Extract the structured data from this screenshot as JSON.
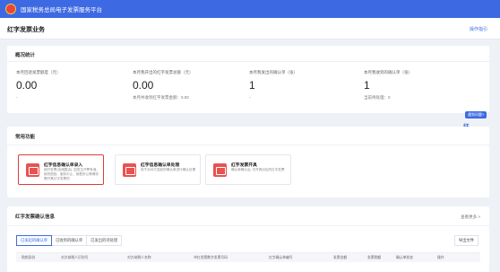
{
  "topbar": {
    "title": "国家税务总局电子发票服务平台"
  },
  "page": {
    "title": "红字发票业务",
    "guide": "操作指引"
  },
  "overview": {
    "title": "概况统计",
    "stats": [
      {
        "label": "本月回退发票额度（元）",
        "value": "0.00",
        "sub": "-"
      },
      {
        "label": "本月我开出的红字发票总额（元）",
        "value": "0.00",
        "sub": "本月共收到红字发票金额：0.00"
      },
      {
        "label": "本月我发出的确认单（张）",
        "value": "1",
        "sub": "-"
      },
      {
        "label": "本月我收到的确认单（张）",
        "value": "1",
        "sub": "当前待处理：0"
      }
    ]
  },
  "functions": {
    "title": "常用功能",
    "items": [
      {
        "name": "红字信息确认单录入",
        "desc": "填开发票(含调整)后, 如发生开票有误、销货退回、服务中止、销售折让等情形需开具红字发票的"
      },
      {
        "name": "红字信息确认单处理",
        "desc": "用于对对方发起的确认单进行确认处理"
      },
      {
        "name": "红字发票开具",
        "desc": "确认单确认后, 可开具对应的红字发票"
      }
    ]
  },
  "helper": {
    "tag": "遇到问题?",
    "chars": [
      "征",
      "纳",
      "互",
      "动"
    ]
  },
  "confirm": {
    "title": "红字发票确认信息",
    "more": "查看更多 >",
    "tabs": [
      "已发起的确认单",
      "已收到的确认单",
      "已发出的待处理"
    ],
    "export": "导出文件",
    "columns": [
      "购销身份",
      "对方纳税人识别号",
      "对方纳税人名称",
      "冲红发票数字发票号码",
      "红字确认单编号",
      "发票金额",
      "发票税额",
      "确认单状态",
      "操作"
    ]
  },
  "colors": {
    "brand": "#3d6ae3",
    "highlight": "#e23a3a",
    "fn_icon": "#e85250"
  }
}
